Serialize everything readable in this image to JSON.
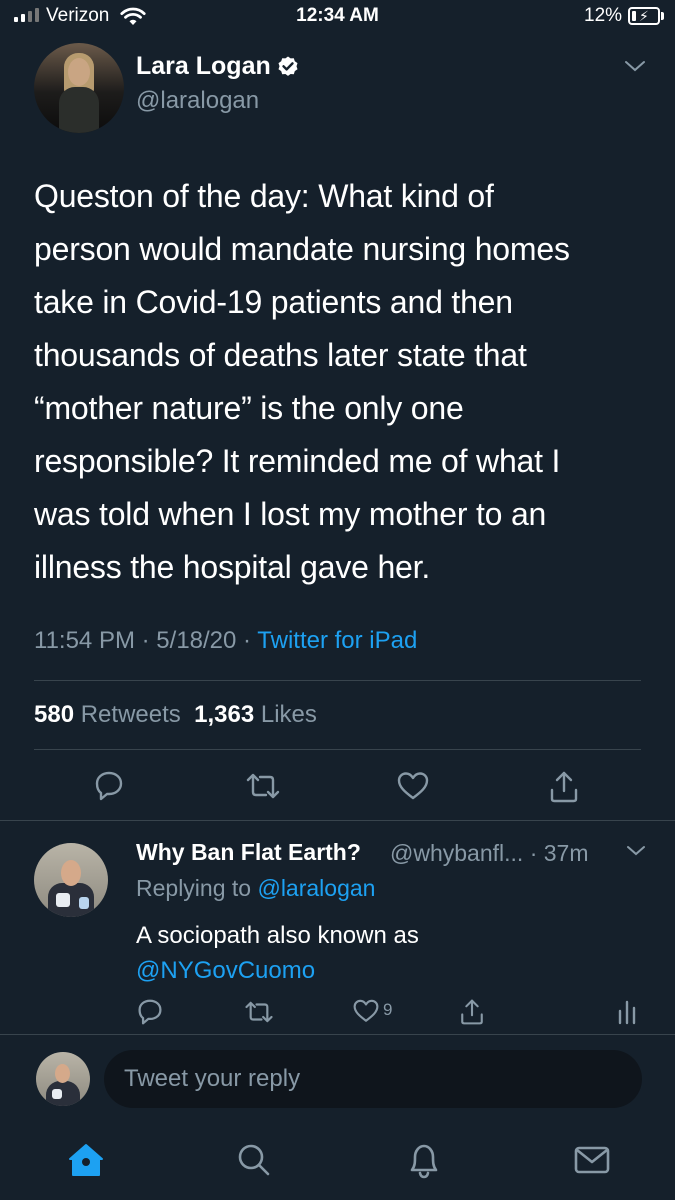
{
  "status_bar": {
    "carrier": "Verizon",
    "time": "12:34 AM",
    "battery_percent": "12%"
  },
  "tweet": {
    "author_name": "Lara Logan",
    "author_handle": "@laralogan",
    "verified": true,
    "text_lines": [
      "Queston of the day: What kind of",
      "person would mandate nursing homes",
      "take in Covid-19 patients and then",
      "thousands of deaths later state that",
      "“mother nature” is the only one",
      "responsible? It reminded me of what I",
      "was told when I lost my mother to an",
      "illness the hospital gave her."
    ],
    "time": "11:54 PM",
    "date": "5/18/20",
    "separator": "·",
    "source": "Twitter for iPad",
    "retweet_count": "580",
    "retweets_label": "Retweets",
    "like_count": "1,363",
    "likes_label": "Likes"
  },
  "reply": {
    "author_name": "Why Ban Flat Earth?",
    "author_handle": "@whybanfl...",
    "age": "· 37m",
    "replying_to_label": "Replying to",
    "replying_to_handle": "@laralogan",
    "text_line1": "A sociopath also known as",
    "text_mention": "@NYGovCuomo",
    "like_count": "9"
  },
  "compose": {
    "placeholder": "Tweet your reply"
  },
  "tab_bar": {
    "icons": [
      "home-icon",
      "search-icon",
      "notifications-bell-icon",
      "messages-envelope-icon"
    ],
    "active": "home-icon"
  },
  "colors": {
    "background": "#15202b",
    "accent": "#1da1f2",
    "secondary_text": "#8899a6",
    "divider": "#38444d"
  }
}
